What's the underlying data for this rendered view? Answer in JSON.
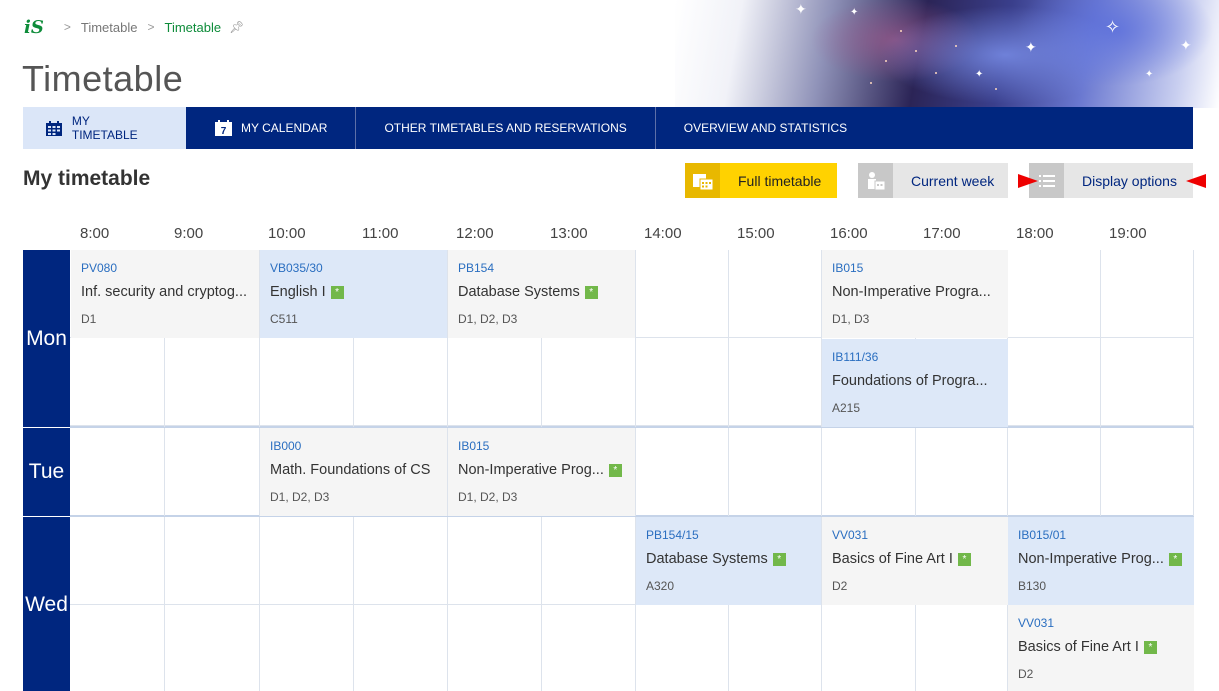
{
  "breadcrumb": {
    "logo": "iS",
    "items": [
      "Timetable",
      "Timetable"
    ]
  },
  "page_title": "Timetable",
  "nav": [
    {
      "label": "MY TIMETABLE",
      "icon": "grid-calendar-icon"
    },
    {
      "label": "MY CALENDAR",
      "icon": "calendar-7-icon"
    },
    {
      "label": "OTHER TIMETABLES AND RESERVATIONS"
    },
    {
      "label": "OVERVIEW AND STATISTICS"
    }
  ],
  "subtitle": "My timetable",
  "buttons": {
    "full": "Full timetable",
    "week": "Current week",
    "display": "Display options"
  },
  "hours": [
    "8:00",
    "9:00",
    "10:00",
    "11:00",
    "12:00",
    "13:00",
    "14:00",
    "15:00",
    "16:00",
    "17:00",
    "18:00",
    "19:00"
  ],
  "days": [
    "Mon",
    "Tue",
    "Wed"
  ],
  "slots": [
    {
      "code": "PV080",
      "name": "Inf. security and cryptog...",
      "room": "D1"
    },
    {
      "code": "VB035/30",
      "name": "English I",
      "room": "C511"
    },
    {
      "code": "PB154",
      "name": "Database Systems",
      "room": "D1, D2, D3"
    },
    {
      "code": "IB015",
      "name": "Non-Imperative Progra...",
      "room": "D1, D3"
    },
    {
      "code": "IB111/36",
      "name": "Foundations of Progra...",
      "room": "A215"
    },
    {
      "code": "IB000",
      "name": "Math. Foundations of CS",
      "room": "D1, D2, D3"
    },
    {
      "code": "IB015",
      "name": "Non-Imperative Prog...",
      "room": "D1, D2, D3"
    },
    {
      "code": "PB154/15",
      "name": "Database Systems",
      "room": "A320"
    },
    {
      "code": "VV031",
      "name": "Basics of Fine Art I",
      "room": "D2"
    },
    {
      "code": "IB015/01",
      "name": "Non-Imperative Prog...",
      "room": "B130"
    },
    {
      "code": "VV031",
      "name": "Basics of Fine Art I",
      "room": "D2"
    }
  ]
}
